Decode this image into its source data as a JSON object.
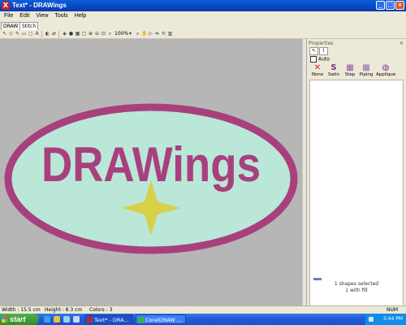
{
  "window": {
    "title": "Text* - DRAWings",
    "icon": "X"
  },
  "menu": [
    "File",
    "Edit",
    "View",
    "Tools",
    "Help"
  ],
  "tabs": [
    "DRAW",
    "Stitch"
  ],
  "toolbar": {
    "zoom": "100%"
  },
  "canvas": {
    "design_text": "DRAWings",
    "fabric_color": "#b4b4b4",
    "oval_fill": "#b6e6d6",
    "border_color": "#a8407e",
    "star_color": "#d8d048"
  },
  "properties": {
    "title": "Properties",
    "checkbox_label": "Auto",
    "stitch_types": [
      {
        "icon": "none-icon",
        "glyph": "✕",
        "label": "None",
        "color": "#d02020"
      },
      {
        "icon": "satin-icon",
        "glyph": "S",
        "label": "Satin",
        "color": "#7a2d8a"
      },
      {
        "icon": "step-icon",
        "glyph": "▦",
        "label": "Step",
        "color": "#8a5aa0"
      },
      {
        "icon": "piping-icon",
        "glyph": "▩",
        "label": "Piping",
        "color": "#9a6ab0"
      },
      {
        "icon": "applique-icon",
        "glyph": "◍",
        "label": "Applique",
        "color": "#7a3a8a"
      }
    ],
    "status_line1": "1 shapes selected",
    "status_line2": "1 with fill"
  },
  "statusbar": {
    "width": "Width : 15.5 cm",
    "height": "Height : 8.3 cm",
    "colors": "Colors : 3",
    "num": "NUM"
  },
  "taskbar": {
    "start": "start",
    "tasks": [
      "Text* - DRA...",
      "CorelDRAW ..."
    ],
    "clock": "3:44 PM"
  }
}
